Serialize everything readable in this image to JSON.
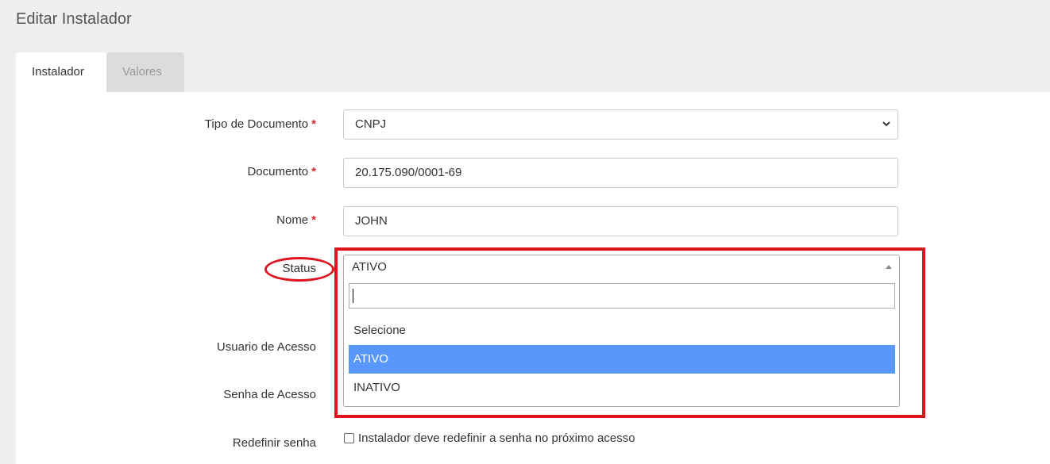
{
  "page": {
    "title": "Editar Instalador"
  },
  "tabs": [
    {
      "label": "Instalador",
      "active": true
    },
    {
      "label": "Valores",
      "active": false
    }
  ],
  "form": {
    "tipo_documento": {
      "label": "Tipo de Documento",
      "required_mark": "*",
      "value": "CNPJ"
    },
    "documento": {
      "label": "Documento",
      "required_mark": "*",
      "value": "20.175.090/0001-69"
    },
    "nome": {
      "label": "Nome",
      "required_mark": "*",
      "value": "JOHN"
    },
    "status": {
      "label": "Status",
      "value": "ATIVO",
      "search_value": "",
      "options": [
        {
          "label": "Selecione",
          "selected": false
        },
        {
          "label": "ATIVO",
          "selected": true
        },
        {
          "label": "INATIVO",
          "selected": false
        }
      ]
    },
    "usuario_acesso": {
      "label": "Usuario de Acesso"
    },
    "senha_acesso": {
      "label": "Senha de Acesso"
    },
    "redefinir_senha": {
      "label": "Redefinir senha",
      "checkbox_text": "Instalador deve redefinir a senha no próximo acesso",
      "checked": false
    }
  },
  "annotation": {
    "color": "#e0141e"
  },
  "colors": {
    "selected_option": "#5897fb",
    "required": "#d9232d"
  }
}
